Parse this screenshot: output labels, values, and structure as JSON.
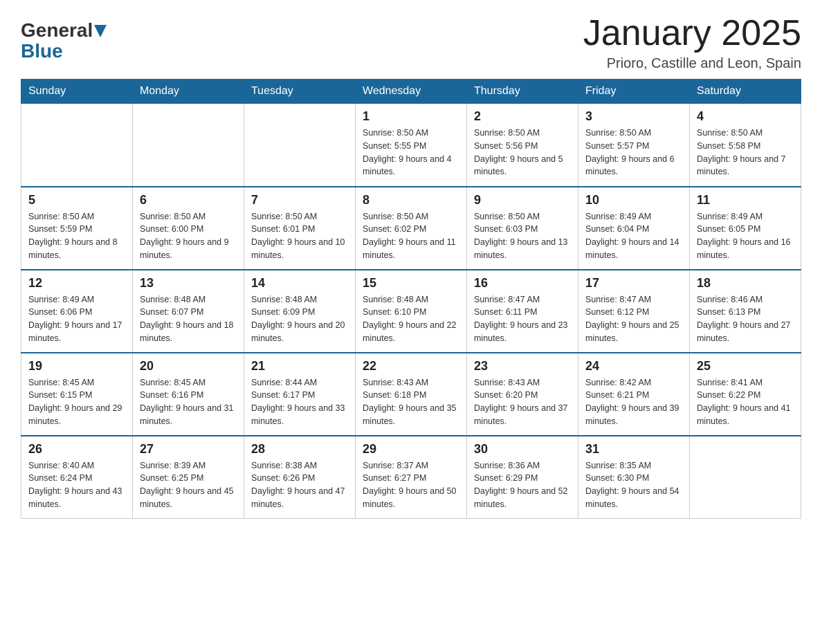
{
  "header": {
    "logo_general": "General",
    "logo_blue": "Blue",
    "month_title": "January 2025",
    "location": "Prioro, Castille and Leon, Spain"
  },
  "weekdays": [
    "Sunday",
    "Monday",
    "Tuesday",
    "Wednesday",
    "Thursday",
    "Friday",
    "Saturday"
  ],
  "weeks": [
    [
      {
        "day": "",
        "info": ""
      },
      {
        "day": "",
        "info": ""
      },
      {
        "day": "",
        "info": ""
      },
      {
        "day": "1",
        "info": "Sunrise: 8:50 AM\nSunset: 5:55 PM\nDaylight: 9 hours and 4 minutes."
      },
      {
        "day": "2",
        "info": "Sunrise: 8:50 AM\nSunset: 5:56 PM\nDaylight: 9 hours and 5 minutes."
      },
      {
        "day": "3",
        "info": "Sunrise: 8:50 AM\nSunset: 5:57 PM\nDaylight: 9 hours and 6 minutes."
      },
      {
        "day": "4",
        "info": "Sunrise: 8:50 AM\nSunset: 5:58 PM\nDaylight: 9 hours and 7 minutes."
      }
    ],
    [
      {
        "day": "5",
        "info": "Sunrise: 8:50 AM\nSunset: 5:59 PM\nDaylight: 9 hours and 8 minutes."
      },
      {
        "day": "6",
        "info": "Sunrise: 8:50 AM\nSunset: 6:00 PM\nDaylight: 9 hours and 9 minutes."
      },
      {
        "day": "7",
        "info": "Sunrise: 8:50 AM\nSunset: 6:01 PM\nDaylight: 9 hours and 10 minutes."
      },
      {
        "day": "8",
        "info": "Sunrise: 8:50 AM\nSunset: 6:02 PM\nDaylight: 9 hours and 11 minutes."
      },
      {
        "day": "9",
        "info": "Sunrise: 8:50 AM\nSunset: 6:03 PM\nDaylight: 9 hours and 13 minutes."
      },
      {
        "day": "10",
        "info": "Sunrise: 8:49 AM\nSunset: 6:04 PM\nDaylight: 9 hours and 14 minutes."
      },
      {
        "day": "11",
        "info": "Sunrise: 8:49 AM\nSunset: 6:05 PM\nDaylight: 9 hours and 16 minutes."
      }
    ],
    [
      {
        "day": "12",
        "info": "Sunrise: 8:49 AM\nSunset: 6:06 PM\nDaylight: 9 hours and 17 minutes."
      },
      {
        "day": "13",
        "info": "Sunrise: 8:48 AM\nSunset: 6:07 PM\nDaylight: 9 hours and 18 minutes."
      },
      {
        "day": "14",
        "info": "Sunrise: 8:48 AM\nSunset: 6:09 PM\nDaylight: 9 hours and 20 minutes."
      },
      {
        "day": "15",
        "info": "Sunrise: 8:48 AM\nSunset: 6:10 PM\nDaylight: 9 hours and 22 minutes."
      },
      {
        "day": "16",
        "info": "Sunrise: 8:47 AM\nSunset: 6:11 PM\nDaylight: 9 hours and 23 minutes."
      },
      {
        "day": "17",
        "info": "Sunrise: 8:47 AM\nSunset: 6:12 PM\nDaylight: 9 hours and 25 minutes."
      },
      {
        "day": "18",
        "info": "Sunrise: 8:46 AM\nSunset: 6:13 PM\nDaylight: 9 hours and 27 minutes."
      }
    ],
    [
      {
        "day": "19",
        "info": "Sunrise: 8:45 AM\nSunset: 6:15 PM\nDaylight: 9 hours and 29 minutes."
      },
      {
        "day": "20",
        "info": "Sunrise: 8:45 AM\nSunset: 6:16 PM\nDaylight: 9 hours and 31 minutes."
      },
      {
        "day": "21",
        "info": "Sunrise: 8:44 AM\nSunset: 6:17 PM\nDaylight: 9 hours and 33 minutes."
      },
      {
        "day": "22",
        "info": "Sunrise: 8:43 AM\nSunset: 6:18 PM\nDaylight: 9 hours and 35 minutes."
      },
      {
        "day": "23",
        "info": "Sunrise: 8:43 AM\nSunset: 6:20 PM\nDaylight: 9 hours and 37 minutes."
      },
      {
        "day": "24",
        "info": "Sunrise: 8:42 AM\nSunset: 6:21 PM\nDaylight: 9 hours and 39 minutes."
      },
      {
        "day": "25",
        "info": "Sunrise: 8:41 AM\nSunset: 6:22 PM\nDaylight: 9 hours and 41 minutes."
      }
    ],
    [
      {
        "day": "26",
        "info": "Sunrise: 8:40 AM\nSunset: 6:24 PM\nDaylight: 9 hours and 43 minutes."
      },
      {
        "day": "27",
        "info": "Sunrise: 8:39 AM\nSunset: 6:25 PM\nDaylight: 9 hours and 45 minutes."
      },
      {
        "day": "28",
        "info": "Sunrise: 8:38 AM\nSunset: 6:26 PM\nDaylight: 9 hours and 47 minutes."
      },
      {
        "day": "29",
        "info": "Sunrise: 8:37 AM\nSunset: 6:27 PM\nDaylight: 9 hours and 50 minutes."
      },
      {
        "day": "30",
        "info": "Sunrise: 8:36 AM\nSunset: 6:29 PM\nDaylight: 9 hours and 52 minutes."
      },
      {
        "day": "31",
        "info": "Sunrise: 8:35 AM\nSunset: 6:30 PM\nDaylight: 9 hours and 54 minutes."
      },
      {
        "day": "",
        "info": ""
      }
    ]
  ]
}
